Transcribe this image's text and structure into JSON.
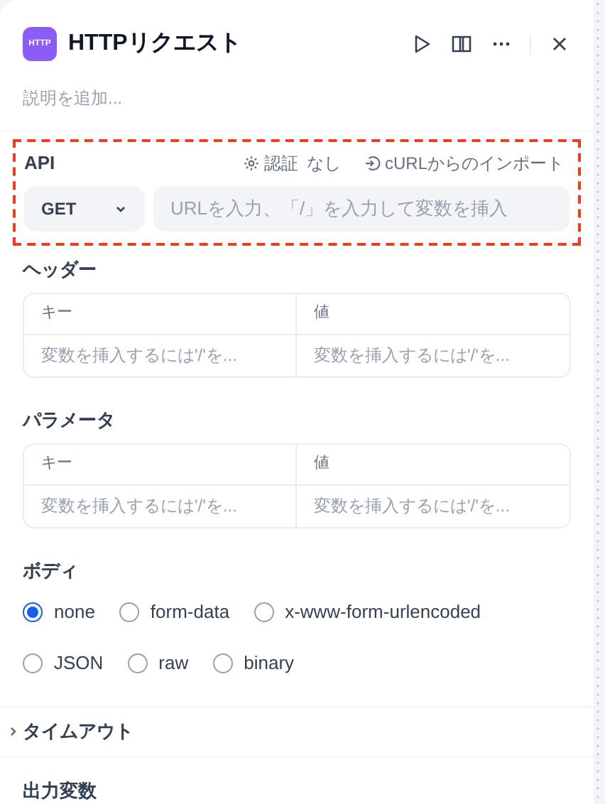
{
  "header": {
    "icon_text": "HTTP",
    "title": "HTTPリクエスト",
    "description_placeholder": "説明を追加..."
  },
  "api": {
    "highlighted": true,
    "label": "API",
    "auth_label": "認証",
    "auth_value": "なし",
    "import_label": "cURLからのインポート",
    "method": "GET",
    "url_placeholder": "URLを入力、「/」を入力して変数を挿入"
  },
  "headers": {
    "title": "ヘッダー",
    "columns": [
      "キー",
      "値"
    ],
    "placeholders": [
      "変数を挿入するには'/'を...",
      "変数を挿入するには'/'を..."
    ]
  },
  "params": {
    "title": "パラメータ",
    "columns": [
      "キー",
      "値"
    ],
    "placeholders": [
      "変数を挿入するには'/'を...",
      "変数を挿入するには'/'を..."
    ]
  },
  "body": {
    "title": "ボディ",
    "options": [
      {
        "label": "none",
        "selected": true
      },
      {
        "label": "form-data",
        "selected": false
      },
      {
        "label": "x-www-form-urlencoded",
        "selected": false
      },
      {
        "label": "JSON",
        "selected": false
      },
      {
        "label": "raw",
        "selected": false
      },
      {
        "label": "binary",
        "selected": false
      }
    ]
  },
  "timeout": {
    "title": "タイムアウト",
    "expanded": false
  },
  "output": {
    "title": "出力変数"
  }
}
